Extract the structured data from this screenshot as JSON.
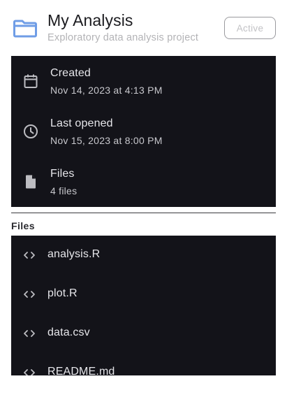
{
  "project": {
    "title": "My Analysis",
    "description": "Exploratory data analysis project",
    "status": "Active",
    "icon": "folder-icon"
  },
  "info": [
    {
      "icon": "calendar-icon",
      "label": "Created",
      "value": "Nov 14, 2023 at 4:13 PM"
    },
    {
      "icon": "clock-icon",
      "label": "Last opened",
      "value": "Nov 15, 2023 at 8:00 PM"
    },
    {
      "icon": "file-icon",
      "label": "Files",
      "value": "4 files"
    }
  ],
  "files_section": {
    "title": "Files",
    "items": [
      {
        "icon": "code-icon",
        "name": "analysis.R"
      },
      {
        "icon": "code-icon",
        "name": "plot.R"
      },
      {
        "icon": "code-icon",
        "name": "data.csv"
      },
      {
        "icon": "code-icon",
        "name": "README.md"
      }
    ]
  },
  "colors": {
    "accent": "#6f9de6",
    "panel_bg": "#131319",
    "panel_text": "#e6e6ea",
    "icon_gray": "#bdbdc2"
  }
}
